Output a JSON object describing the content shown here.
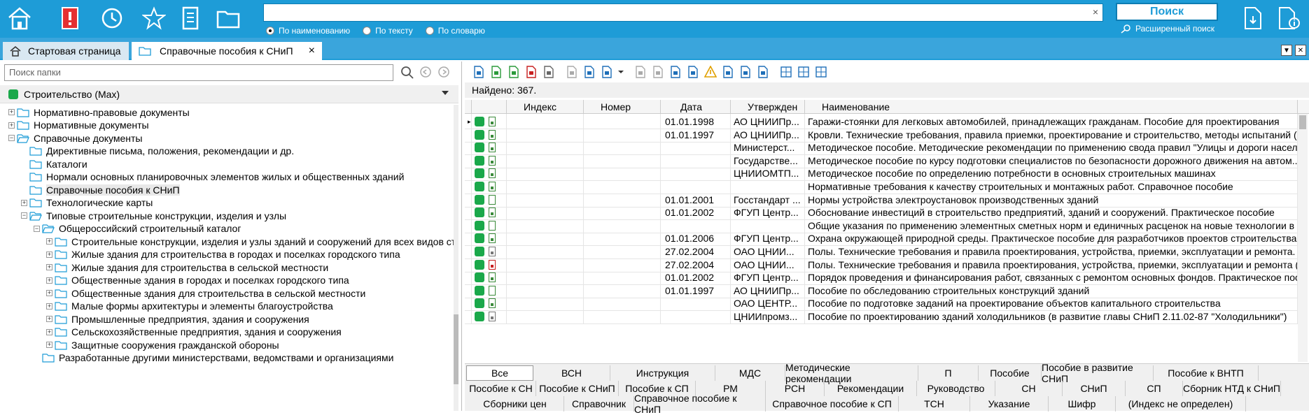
{
  "search": {
    "value": "",
    "clear_icon": "×"
  },
  "search_modes": [
    {
      "label": "По наименованию",
      "checked": true
    },
    {
      "label": "По тексту",
      "checked": false
    },
    {
      "label": "По словарю",
      "checked": false
    }
  ],
  "find_label": "Поиск",
  "advanced_search_label": "Расширенный поиск",
  "tabs": {
    "start": "Стартовая страница",
    "current": "Справочные пособия к СНиП",
    "close": "×"
  },
  "folder_search_placeholder": "Поиск папки",
  "root_label": "Строительство (Max)",
  "tree": [
    {
      "label": "Нормативно-правовые документы",
      "exp": "+"
    },
    {
      "label": "Нормативные документы",
      "exp": "+"
    },
    {
      "label": "Справочные документы",
      "exp": "−"
    },
    {
      "label": "Директивные письма, положения, рекомендации и др.",
      "exp": ""
    },
    {
      "label": "Каталоги",
      "exp": ""
    },
    {
      "label": "Нормали основных планировочных элементов жилых и общественных зданий",
      "exp": ""
    },
    {
      "label": "Справочные пособия к СНиП",
      "exp": ""
    },
    {
      "label": "Технологические карты",
      "exp": "+"
    },
    {
      "label": "Типовые строительные конструкции, изделия и узлы",
      "exp": "−"
    },
    {
      "label": "Общероссийский строительный каталог",
      "exp": "−"
    },
    {
      "label": "Строительные конструкции, изделия и узлы зданий и сооружений для всех видов стро",
      "exp": "+"
    },
    {
      "label": "Жилые здания для строительства в городах и поселках городского типа",
      "exp": "+"
    },
    {
      "label": "Жилые здания для строительства в сельской местности",
      "exp": "+"
    },
    {
      "label": "Общественные здания в городах и поселках городского типа",
      "exp": "+"
    },
    {
      "label": "Общественные здания для строительства в сельской местности",
      "exp": "+"
    },
    {
      "label": "Малые формы архитектуры и элементы благоустройства",
      "exp": "+"
    },
    {
      "label": "Промышленные предприятия, здания и сооружения",
      "exp": "+"
    },
    {
      "label": "Сельскохозяйственные предприятия, здания и сооружения",
      "exp": "+"
    },
    {
      "label": "Защитные сооружения гражданской обороны",
      "exp": "+"
    },
    {
      "label": "Разработанные другими министерствами, ведомствами и организациями",
      "exp": ""
    }
  ],
  "found_label": "Найдено: 367.",
  "columns": [
    "Индекс",
    "Номер",
    "Дата",
    "Утвержден",
    "Наименование"
  ],
  "rows": [
    {
      "date": "01.01.1998",
      "approved": "АО ЦНИИПр...",
      "name": "Гаражи-стоянки для легковых автомобилей, принадлежащих гражданам. Пособие для проектирования",
      "doc": "green"
    },
    {
      "date": "01.01.1997",
      "approved": "АО ЦНИИПр...",
      "name": "Кровли. Технические требования, правила приемки, проектирование и строительство, методы испытаний (п...",
      "doc": "green"
    },
    {
      "date": "",
      "approved": "Министерст...",
      "name": "Методическое пособие. Методические рекомендации по применению свода правил \"Улицы и дороги насел...",
      "doc": "green"
    },
    {
      "date": "",
      "approved": "Государстве...",
      "name": "Методическое пособие по курсу подготовки специалистов по безопасности дорожного движения на автом...",
      "doc": "green"
    },
    {
      "date": "",
      "approved": "ЦНИИОМТП...",
      "name": "Методическое пособие по определению потребности в основных строительных машинах",
      "doc": "green"
    },
    {
      "date": "",
      "approved": "",
      "name": "Нормативные требования к качеству строительных и монтажных работ. Справочное пособие",
      "doc": "green"
    },
    {
      "date": "01.01.2001",
      "approved": "Госстандарт ...",
      "name": "Нормы устройства электроустановок производственных зданий",
      "doc": "white"
    },
    {
      "date": "01.01.2002",
      "approved": "ФГУП Центр...",
      "name": "Обоснование инвестиций в строительство предприятий, зданий и сооружений. Практическое пособие",
      "doc": "green"
    },
    {
      "date": "",
      "approved": "",
      "name": "Общие указания по применению элементных сметных норм и единичных расценок на новые технологии в ...",
      "doc": "white"
    },
    {
      "date": "01.01.2006",
      "approved": "ФГУП Центр...",
      "name": "Охрана окружающей природной среды. Практическое пособие для разработчиков проектов строительства",
      "doc": "green"
    },
    {
      "date": "27.02.2004",
      "approved": "ОАО ЦНИИ...",
      "name": "Полы. Технические требования и правила проектирования, устройства, приемки, эксплуатации и ремонта. С...",
      "doc": "gray"
    },
    {
      "date": "27.02.2004",
      "approved": "ОАО ЦНИИ...",
      "name": "Полы. Технические требования и правила проектирования, устройства, приемки, эксплуатации и ремонта (в...",
      "doc": "red"
    },
    {
      "date": "01.01.2002",
      "approved": "ФГУП Центр...",
      "name": "Порядок проведения и финансирования работ, связанных с ремонтом основных фондов. Практическое пос...",
      "doc": "green"
    },
    {
      "date": "01.01.1997",
      "approved": "АО ЦНИИПр...",
      "name": "Пособие по обследованию строительных конструкций зданий",
      "doc": "white"
    },
    {
      "date": "",
      "approved": "ОАО ЦЕНТР...",
      "name": "Пособие по подготовке заданий на проектирование объектов капитального строительства",
      "doc": "green"
    },
    {
      "date": "",
      "approved": "ЦНИИпромз...",
      "name": "Пособие по проектированию зданий холодильников (в развитие главы СНиП 2.11.02-87 \"Холодильники\")",
      "doc": "gray"
    }
  ],
  "filter_rows": [
    [
      "Все",
      "ВСН",
      "Инструкция",
      "МДС",
      "Методические рекомендации",
      "П",
      "Пособие",
      "Пособие в развитие СНиП",
      "Пособие к ВНТП"
    ],
    [
      "Пособие к СН",
      "Пособие к СНиП",
      "Пособие к СП",
      "РМ",
      "РСН",
      "Рекомендации",
      "Руководство",
      "СН",
      "СНиП",
      "СП",
      "Сборник НТД к СНиП"
    ],
    [
      "Сборники цен",
      "Справочник",
      "Справочное пособие к СНиП",
      "Справочное пособие к СП",
      "ТСН",
      "Указание",
      "Шифр",
      "(Индекс не определен)"
    ]
  ]
}
